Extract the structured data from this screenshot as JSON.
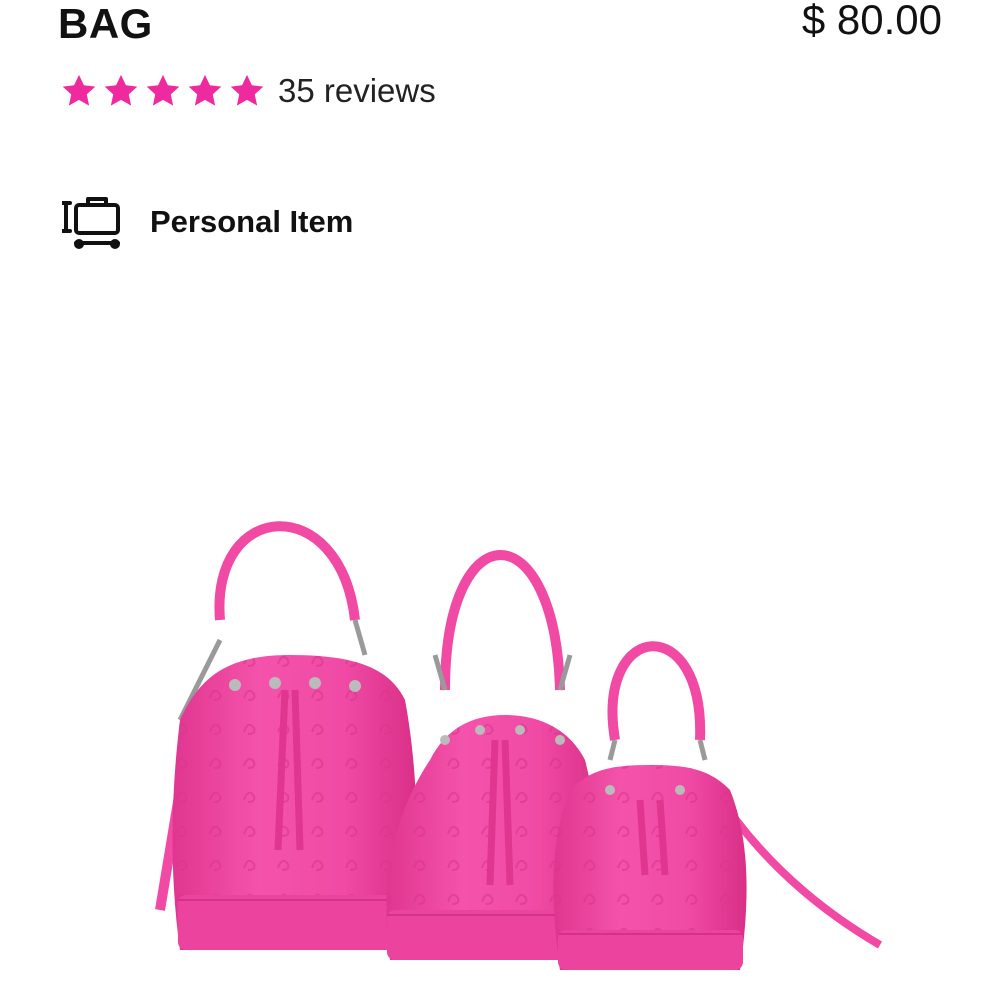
{
  "product": {
    "title": "BAG",
    "price": "$ 80.00"
  },
  "rating": {
    "stars": 5,
    "max_stars": 5,
    "reviews_text": "35 reviews",
    "star_color": "#ee2a9e"
  },
  "item_type": {
    "icon": "luggage-icon",
    "label": "Personal Item"
  },
  "image": {
    "icon": "product-image",
    "bag_color": "#f04aa5",
    "hardware_color": "#9a9a9a"
  }
}
